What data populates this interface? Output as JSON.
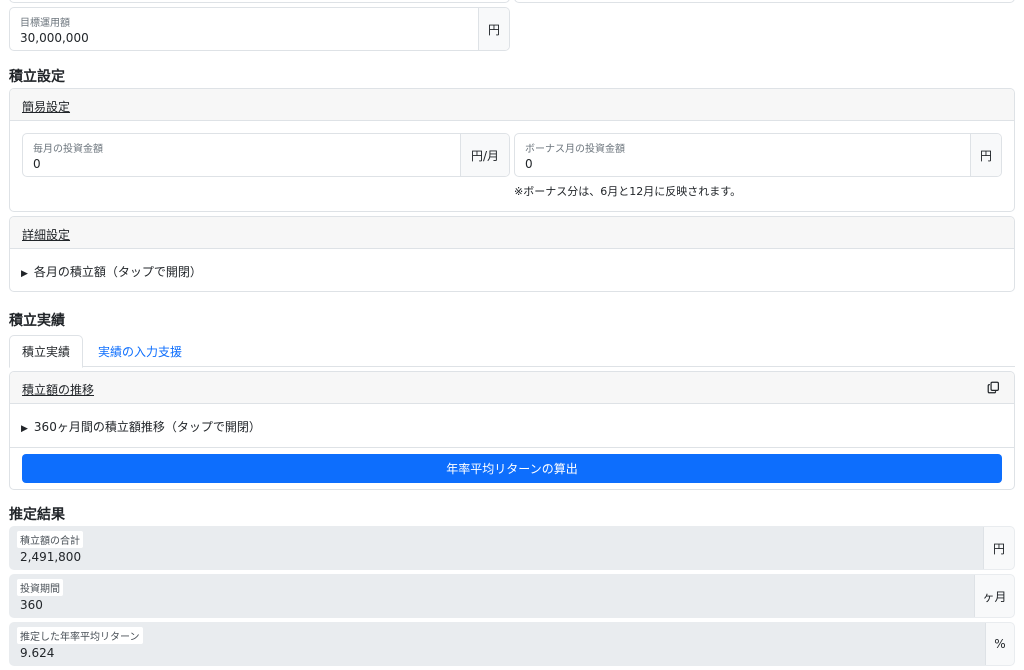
{
  "target": {
    "label": "目標運用額",
    "value": "30,000,000",
    "unit": "円"
  },
  "savings_settings": {
    "title": "積立設定",
    "simple": {
      "header": "簡易設定",
      "monthly": {
        "label": "毎月の投資金額",
        "value": "0",
        "unit": "円/月"
      },
      "bonus": {
        "label": "ボーナス月の投資金額",
        "value": "0",
        "unit": "円"
      },
      "note": "※ボーナス分は、6月と12月に反映されます。"
    },
    "detail": {
      "header": "詳細設定",
      "toggle": "各月の積立額（タップで開閉）"
    }
  },
  "savings_results": {
    "title": "積立実績",
    "tabs": [
      {
        "label": "積立実績"
      },
      {
        "label": "実績の入力支援"
      }
    ],
    "history": {
      "header": "積立額の推移",
      "copy_icon": "copy-icon",
      "toggle": "360ヶ月間の積立額推移（タップで開閉）",
      "button": "年率平均リターンの算出"
    }
  },
  "estimate": {
    "title": "推定結果",
    "total": {
      "label": "積立額の合計",
      "value": "2,491,800",
      "unit": "円"
    },
    "period": {
      "label": "投資期間",
      "value": "360",
      "unit": "ヶ月"
    },
    "return": {
      "label": "推定した年率平均リターン",
      "value": "9.624",
      "unit": "%"
    }
  },
  "colors": {
    "primary": "#0d6efd",
    "border": "#dee2e6",
    "readonly_bg": "#e9ecef"
  }
}
